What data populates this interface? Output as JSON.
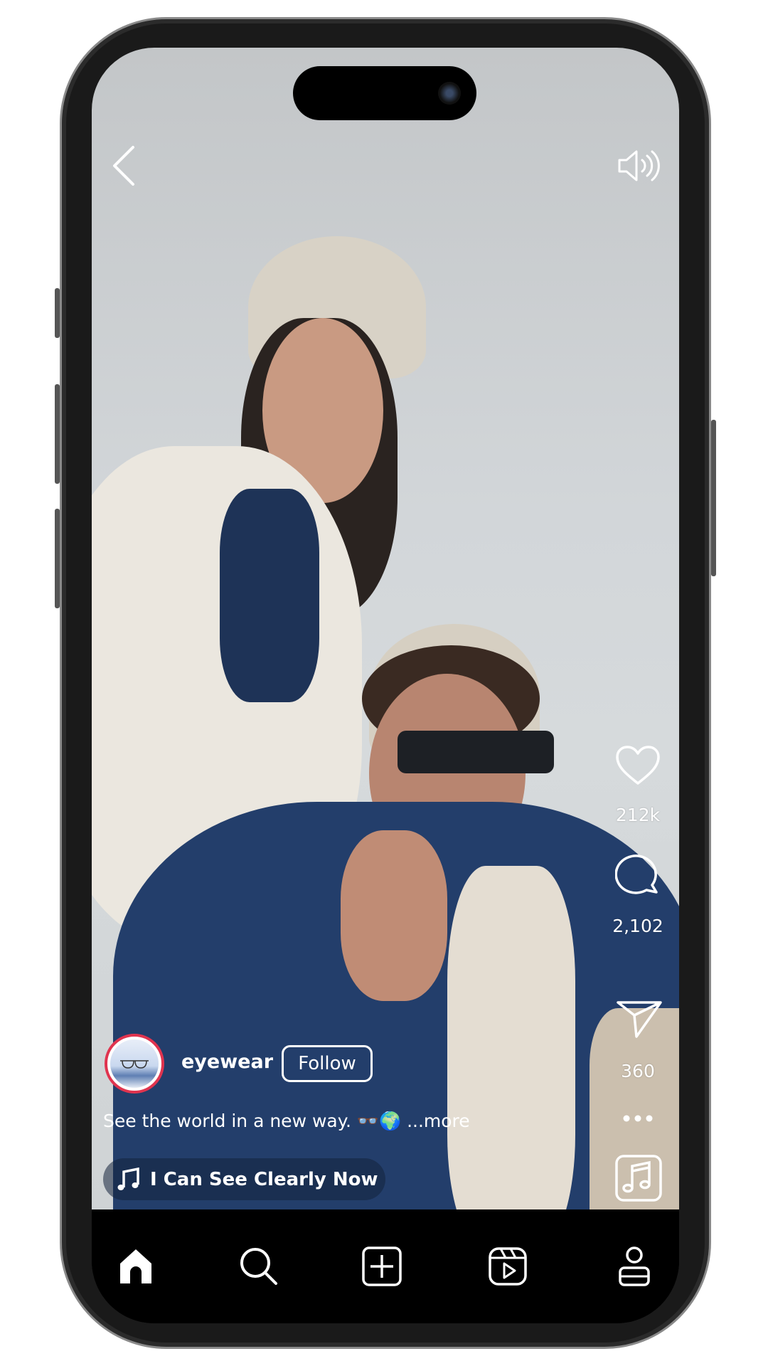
{
  "post": {
    "username": "eyewear",
    "follow_label": "Follow",
    "caption": "See the world in a new way. 👓🌍",
    "more_label": "...more",
    "song": "I Can See Clearly Now"
  },
  "actions": {
    "likes": "212k",
    "comments": "2,102",
    "shares": "360"
  },
  "icons": {
    "back": "chevron-left-icon",
    "sound": "speaker-on-icon",
    "like": "heart-icon",
    "comment": "comment-bubble-icon",
    "share": "paper-plane-icon",
    "more": "more-dots-icon",
    "audio": "music-note-icon",
    "nav": [
      "home-icon",
      "search-icon",
      "create-plus-icon",
      "reels-icon",
      "profile-icon"
    ]
  },
  "colors": {
    "avatar_ring": "#e0344f",
    "nav_bg": "#000000",
    "text": "#ffffff"
  }
}
